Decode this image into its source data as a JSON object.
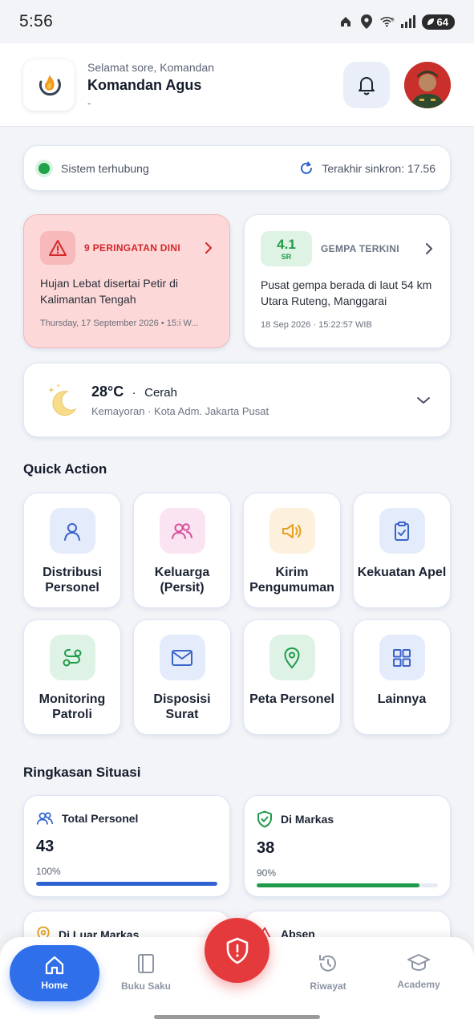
{
  "status_bar": {
    "time": "5:56",
    "battery": "64",
    "wifi_label": "5"
  },
  "header": {
    "greeting": "Selamat sore, Komandan",
    "name": "Komandan Agus",
    "subtitle": "-"
  },
  "sync": {
    "status": "Sistem terhubung",
    "last_sync": "Terakhir sinkron: 17.56"
  },
  "warning": {
    "title": "9 PERINGATAN DINI",
    "description": "Hujan Lebat disertai Petir di Kalimantan Tengah",
    "date": "Thursday, 17 September 2026 • 15:i W..."
  },
  "earthquake": {
    "magnitude": "4.1",
    "unit": "SR",
    "title": "GEMPA TERKINI",
    "description": "Pusat gempa berada di laut 54 km Utara Ruteng, Manggarai",
    "date": "18 Sep 2026 · 15:22:57 WIB"
  },
  "weather": {
    "temp": "28°C",
    "separator": "·",
    "condition": "Cerah",
    "location": "Kemayoran · Kota Adm. Jakarta Pusat"
  },
  "quick_action": {
    "title": "Quick Action",
    "items": [
      {
        "label": "Distribusi Personel",
        "icon": "person-icon",
        "color": "#3a63c9",
        "bg": "#e4ebfb"
      },
      {
        "label": "Keluarga (Persit)",
        "icon": "users-icon",
        "color": "#d64f9c",
        "bg": "#fbe4f1"
      },
      {
        "label": "Kirim Pengumuman",
        "icon": "speaker-icon",
        "color": "#e6a020",
        "bg": "#fdf0dc"
      },
      {
        "label": "Kekuatan Apel",
        "icon": "clipboard-check-icon",
        "color": "#3a63c9",
        "bg": "#e4ebfb"
      },
      {
        "label": "Monitoring Patroli",
        "icon": "route-icon",
        "color": "#1f9a4a",
        "bg": "#def3e5"
      },
      {
        "label": "Disposisi Surat",
        "icon": "mail-icon",
        "color": "#3a63c9",
        "bg": "#e4ebfb"
      },
      {
        "label": "Peta Personel",
        "icon": "map-pin-icon",
        "color": "#1f9a4a",
        "bg": "#def3e5"
      },
      {
        "label": "Lainnya",
        "icon": "grid-icon",
        "color": "#3a63c9",
        "bg": "#e4ebfb"
      }
    ]
  },
  "summary": {
    "title": "Ringkasan Situasi",
    "cards": [
      {
        "label": "Total Personel",
        "value": "43",
        "percent": "100%",
        "fill": 1.0,
        "color": "#2f62d1",
        "icon": "users-icon"
      },
      {
        "label": "Di Markas",
        "value": "38",
        "percent": "90%",
        "fill": 0.9,
        "color": "#1f9a4a",
        "icon": "shield-check-icon"
      },
      {
        "label": "Di Luar Markas",
        "icon": "map-pin-icon"
      },
      {
        "label": "Absen",
        "icon": "alert-icon"
      }
    ]
  },
  "nav": {
    "home": "Home",
    "buku_saku": "Buku Saku",
    "riwayat": "Riwayat",
    "academy": "Academy"
  }
}
